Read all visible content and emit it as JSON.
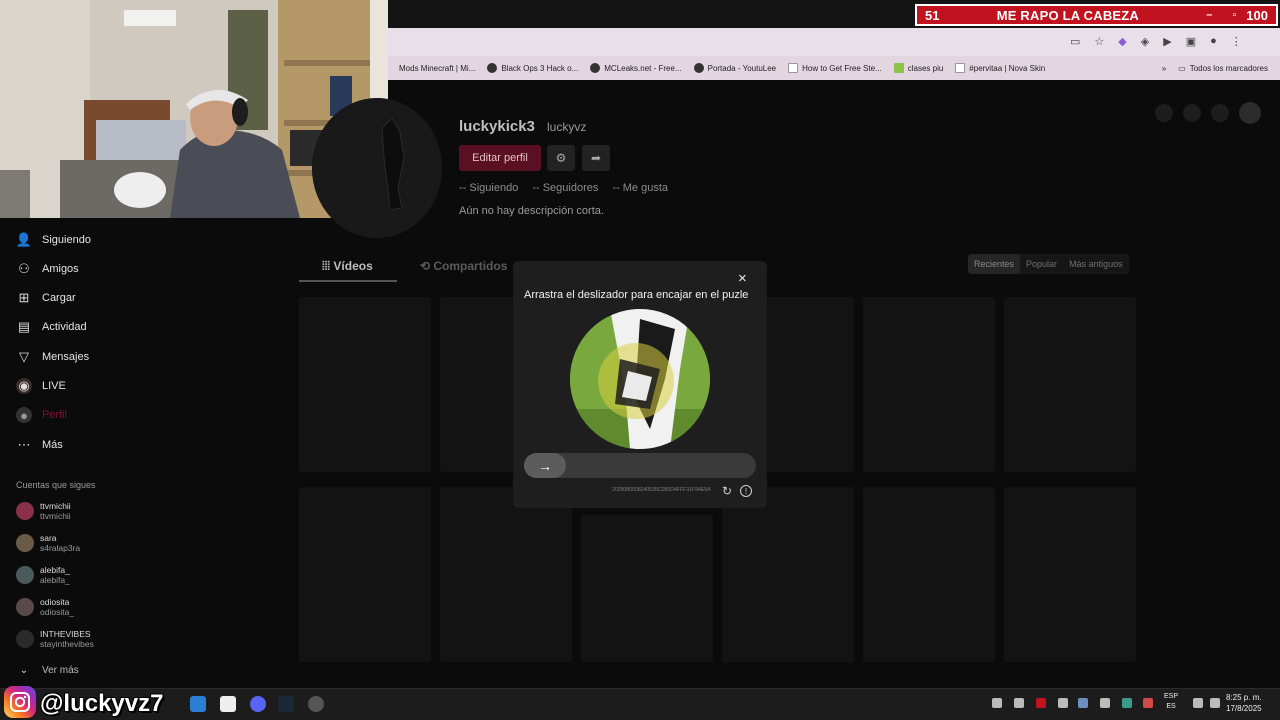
{
  "overlay": {
    "left_number": "51",
    "title": "ME RAPO LA CABEZA",
    "right_number": "100"
  },
  "bookmarks": [
    "Mods Minecraft | Mi...",
    "Black Ops 3 Hack o...",
    "MCLeaks.net - Free...",
    "Portada - YoutuLee",
    "How to Get Free Ste...",
    "clases piu",
    "#pervitaa | Nova Skin"
  ],
  "bookmarks_overflow": "»",
  "all_bookmarks": "Todos los marcadores",
  "sidebar": {
    "items": [
      {
        "label": "Siguiendo",
        "icon": "following-icon"
      },
      {
        "label": "Amigos",
        "icon": "friends-icon"
      },
      {
        "label": "Cargar",
        "icon": "upload-icon"
      },
      {
        "label": "Actividad",
        "icon": "activity-icon"
      },
      {
        "label": "Mensajes",
        "icon": "messages-icon"
      },
      {
        "label": "LIVE",
        "icon": "live-icon"
      },
      {
        "label": "Perfil",
        "icon": "profile-icon"
      },
      {
        "label": "Más",
        "icon": "more-icon"
      }
    ],
    "following_title": "Cuentas que sigues",
    "accounts": [
      {
        "name": "ttvmichii",
        "user": "ttvmichii"
      },
      {
        "name": "sara",
        "user": "s4ralap3ra"
      },
      {
        "name": "alebifa_",
        "user": "alebifa_"
      },
      {
        "name": "odiosita",
        "user": "odiosita_"
      },
      {
        "name": "INTHEVIBES",
        "user": "stayinthevibes"
      }
    ],
    "see_more": "Ver más"
  },
  "profile": {
    "username": "luckykick3",
    "nickname": "luckyvz",
    "edit_button": "Editar perfil",
    "stats": [
      "-- Siguiendo",
      "-- Seguidores",
      "-- Me gusta"
    ],
    "bio": "Aún no hay descripción corta.",
    "tabs": [
      "Vídeos",
      "Compartidos"
    ],
    "sort": [
      "Recientes",
      "Popular",
      "Más antiguos"
    ]
  },
  "captcha": {
    "title": "Arrastra el deslizador para encajar en el puzle",
    "close": "×",
    "slider_arrow": "→",
    "id_text": "2025080508240535C050D4FFF31F94E5A",
    "refresh": "↻",
    "info": "!"
  },
  "taskbar": {
    "handle": "@luckyvz7",
    "lang_top": "ESP",
    "lang_bottom": "ES",
    "time": "8:25 p. m.",
    "date": "17/8/2025"
  }
}
